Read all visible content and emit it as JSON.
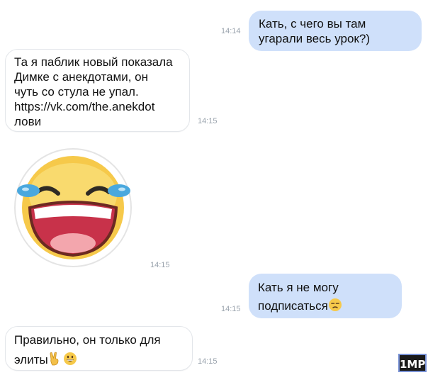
{
  "messages": [
    {
      "direction": "outgoing",
      "lines": [
        "Кать, с чего вы там",
        "угарали весь урок?)"
      ],
      "time": "14:14"
    },
    {
      "direction": "incoming",
      "lines": [
        "Та я паблик новый показала",
        "Димке с анекдотами, он",
        "чуть со стула не упал.",
        "https://vk.com/the.anekdot",
        "лови"
      ],
      "time": "14:15"
    },
    {
      "direction": "incoming",
      "sticker": "laughing-face-tears-sticker",
      "time": "14:15"
    },
    {
      "direction": "outgoing",
      "lines": [
        "Кать я не могу",
        "подписаться"
      ],
      "trailing_emoji": "unamused-face-emoji",
      "time": "14:15"
    },
    {
      "direction": "incoming",
      "lines": [
        "Правильно, он только для",
        "элиты"
      ],
      "trailing_emoji": [
        "victory-hand-emoji",
        "grinning-face-emoji"
      ],
      "time": "14:15"
    }
  ],
  "watermark": "1MP",
  "colors": {
    "outgoing_bubble": "#cfe0fa",
    "incoming_bubble": "#ffffff",
    "timestamp": "#9aa3ad"
  }
}
